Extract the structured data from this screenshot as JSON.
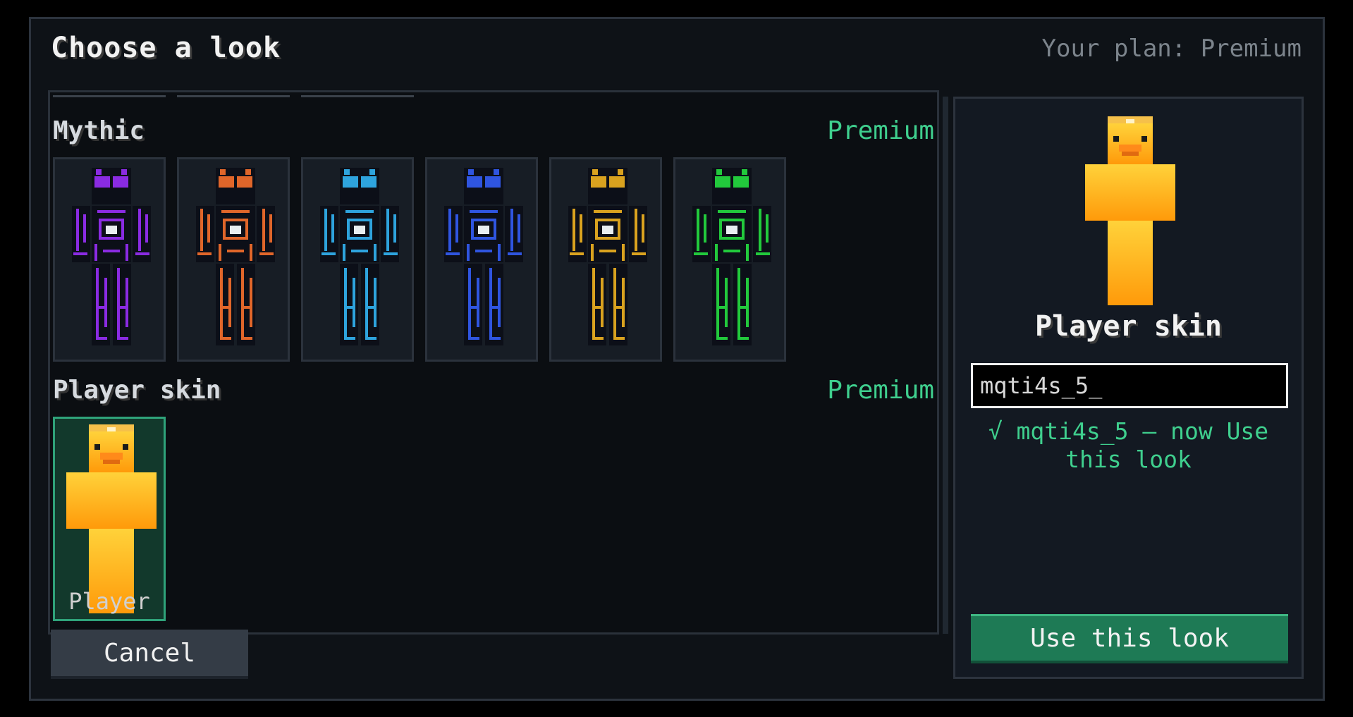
{
  "dialog": {
    "title": "Choose a look",
    "plan_text": "Your plan: Premium"
  },
  "sections": [
    {
      "title": "Mythic",
      "tag": "Premium",
      "items": [
        {
          "color": "#8a2be2",
          "icon": "purple-robot-skin"
        },
        {
          "color": "#e0662a",
          "icon": "orange-robot-skin"
        },
        {
          "color": "#2ea3dd",
          "icon": "cyan-robot-skin"
        },
        {
          "color": "#2f55e0",
          "icon": "blue-robot-skin"
        },
        {
          "color": "#d9a21f",
          "icon": "gold-robot-skin"
        },
        {
          "color": "#22c93c",
          "icon": "green-robot-skin"
        }
      ]
    },
    {
      "title": "Player skin",
      "tag": "Premium",
      "items": [
        {
          "label": "Player",
          "icon": "duck-player-skin",
          "selected": true
        }
      ]
    }
  ],
  "buttons": {
    "cancel": "Cancel",
    "use": "Use this look"
  },
  "preview": {
    "name": "Player skin",
    "input_value": "mqti4s_5_",
    "status": "√ mqti4s_5 — now Use this look"
  },
  "colors": {
    "accent": "#3fcf8e",
    "button_green": "#1e7a55",
    "duck_top": "#ffd23a",
    "duck_bottom": "#ff9a0a"
  }
}
